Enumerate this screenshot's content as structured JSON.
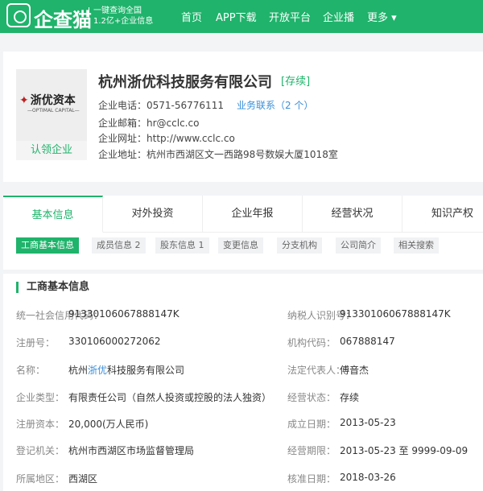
{
  "header": {
    "brand": "企查猫",
    "slogan_line1": "一键查询全国",
    "slogan_line2": "1.2亿+企业信息",
    "nav": [
      "首页",
      "APP下载",
      "开放平台",
      "企业播",
      "更多 ▾"
    ]
  },
  "company": {
    "logo_text": "浙优资本",
    "logo_sub": "—OPTIMAL CAPITAL—",
    "claim": "认领企业",
    "name": "杭州浙优科技服务有限公司",
    "status": "[存续]",
    "phone_label": "企业电话：",
    "phone": "0571-56776111",
    "contact_link": "业务联系（2 个）",
    "email_label": "企业邮箱：",
    "email": "hr@cclc.co",
    "web_label": "企业网址：",
    "web": "http://www.cclc.co",
    "addr_label": "企业地址：",
    "addr": "杭州市西湖区文一西路98号数娱大厦1018室"
  },
  "tabs": [
    "基本信息",
    "对外投资",
    "企业年报",
    "经营状况",
    "知识产权"
  ],
  "subtabs": [
    "工商基本信息",
    "成员信息 2",
    "股东信息 1",
    "变更信息",
    "分支机构",
    "公司简介",
    "相关搜索"
  ],
  "section_title": "工商基本信息",
  "rows": [
    {
      "l": "统一社会信用代码：",
      "v": "91330106067888147K",
      "rl": "纳税人识别号：",
      "rv": "91330106067888147K"
    },
    {
      "l": "注册号：",
      "v": "330106000272062",
      "rl": "机构代码：",
      "rv": "067888147"
    },
    {
      "l": "名称：",
      "v_pre": "杭州",
      "v_hl": "浙优",
      "v_post": "科技服务有限公司",
      "rl": "法定代表人：",
      "rv": "傅音杰"
    },
    {
      "l": "企业类型：",
      "v": "有限责任公司（自然人投资或控股的法人独资）",
      "rl": "经营状态：",
      "rv": "存续"
    },
    {
      "l": "注册资本：",
      "v": "20,000(万人民币)",
      "rl": "成立日期：",
      "rv": "2013-05-23"
    },
    {
      "l": "登记机关：",
      "v": "杭州市西湖区市场监督管理局",
      "rl": "经营期限：",
      "rv": "2013-05-23 至 9999-09-09"
    },
    {
      "l": "所属地区：",
      "v": "西湖区",
      "rl": "核准日期：",
      "rv": "2018-03-26"
    }
  ]
}
